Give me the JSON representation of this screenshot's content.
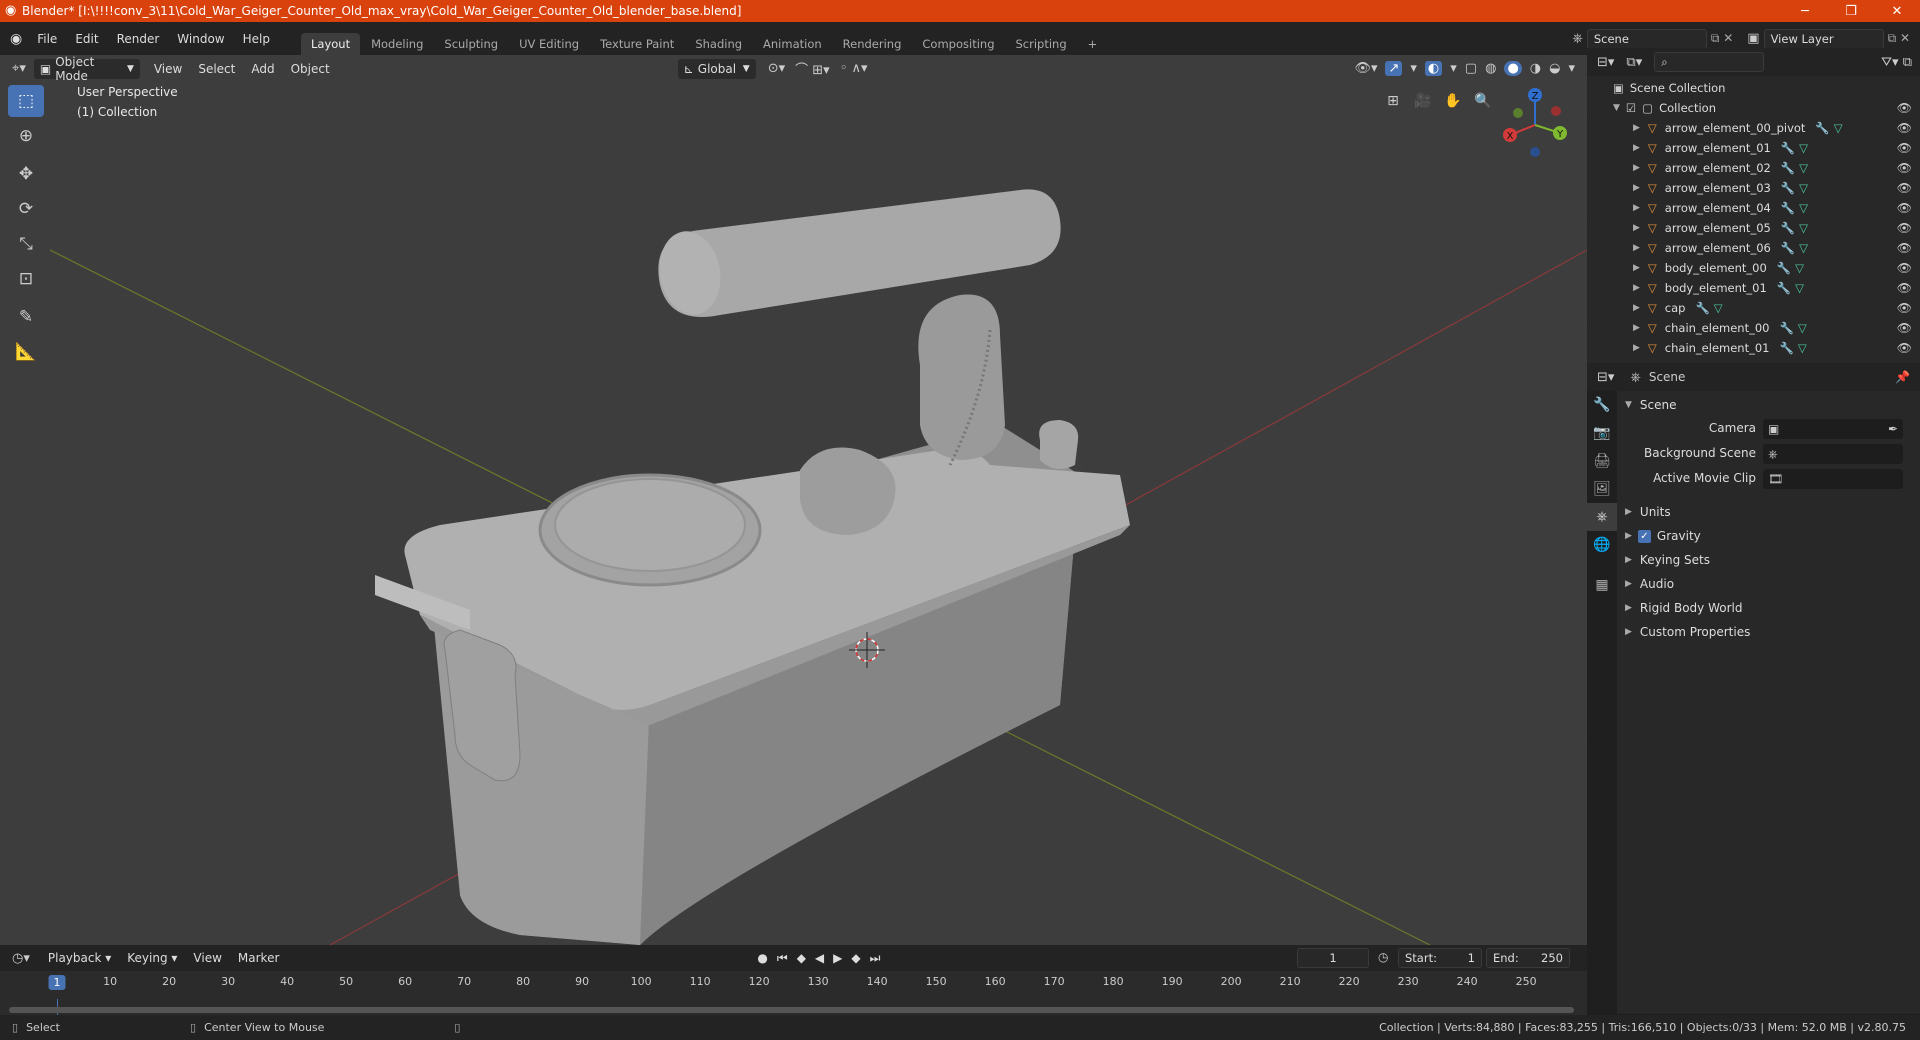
{
  "title": "Blender* [I:\\!!!!conv_3\\11\\Cold_War_Geiger_Counter_Old_max_vray\\Cold_War_Geiger_Counter_Old_blender_base.blend]",
  "menu": [
    "File",
    "Edit",
    "Render",
    "Window",
    "Help"
  ],
  "workspaces": [
    "Layout",
    "Modeling",
    "Sculpting",
    "UV Editing",
    "Texture Paint",
    "Shading",
    "Animation",
    "Rendering",
    "Compositing",
    "Scripting"
  ],
  "active_workspace": "Layout",
  "scene_name": "Scene",
  "view_layer": "View Layer",
  "viewport": {
    "mode": "Object Mode",
    "menus": [
      "View",
      "Select",
      "Add",
      "Object"
    ],
    "transform": "Global",
    "overlay_title": "User Perspective",
    "overlay_collection": "(1) Collection",
    "gizmo_axes": {
      "x": "X",
      "y": "Y",
      "z": "Z"
    }
  },
  "outliner": {
    "root": "Scene Collection",
    "collection": "Collection",
    "items": [
      "arrow_element_00_pivot",
      "arrow_element_01",
      "arrow_element_02",
      "arrow_element_03",
      "arrow_element_04",
      "arrow_element_05",
      "arrow_element_06",
      "body_element_00",
      "body_element_01",
      "cap",
      "chain_element_00",
      "chain_element_01"
    ]
  },
  "properties": {
    "context": "Scene",
    "panel": "Scene",
    "camera_label": "Camera",
    "bg_scene_label": "Background Scene",
    "movie_clip_label": "Active Movie Clip",
    "sections": [
      "Units",
      "Gravity",
      "Keying Sets",
      "Audio",
      "Rigid Body World",
      "Custom Properties"
    ],
    "gravity_checked": true
  },
  "timeline": {
    "menus": [
      "Playback",
      "Keying",
      "View",
      "Marker"
    ],
    "current_frame": "1",
    "start_label": "Start:",
    "start": "1",
    "end_label": "End:",
    "end": "250",
    "ticks": [
      "1",
      "10",
      "20",
      "30",
      "40",
      "50",
      "60",
      "70",
      "80",
      "90",
      "100",
      "110",
      "120",
      "130",
      "140",
      "150",
      "160",
      "170",
      "180",
      "190",
      "200",
      "210",
      "220",
      "230",
      "240",
      "250"
    ]
  },
  "status": {
    "left": "Select",
    "middle": "Center View to Mouse",
    "right": "Collection | Verts:84,880 | Faces:83,255 | Tris:166,510 | Objects:0/33 | Mem: 52.0 MB | v2.80.75"
  },
  "colors": {
    "accent": "#4772b3",
    "titlebar": "#d9420c",
    "object_orange": "#e8913a"
  }
}
